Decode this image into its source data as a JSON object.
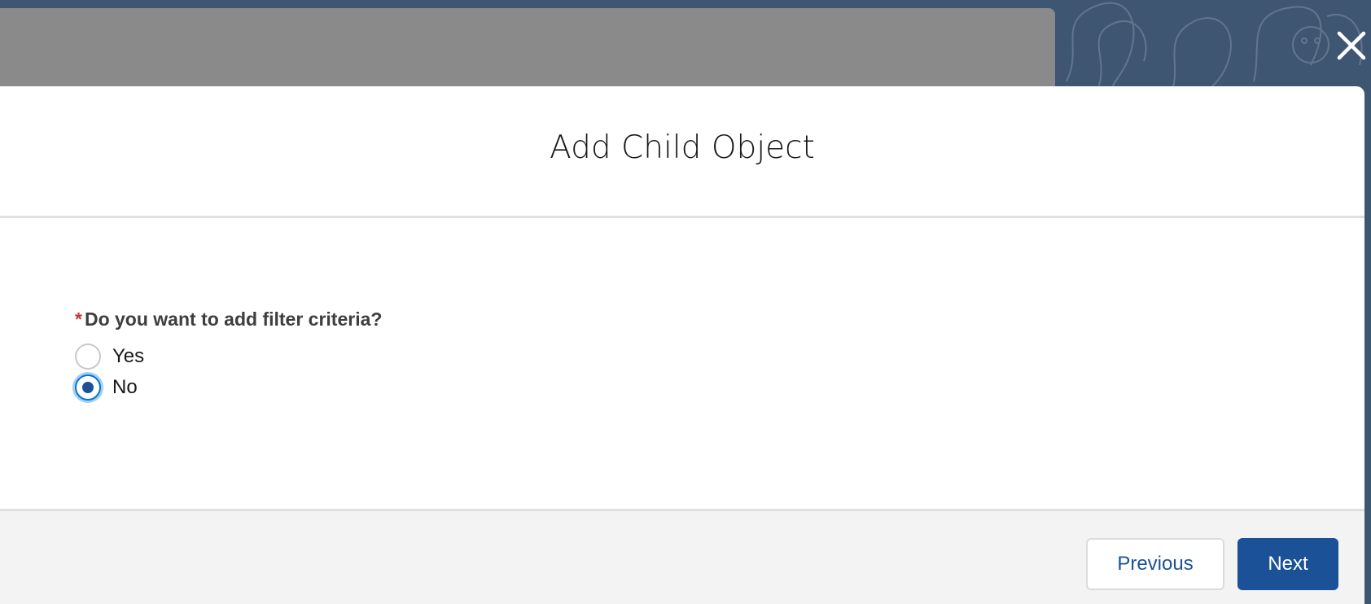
{
  "modal": {
    "title": "Add Child Object"
  },
  "question": {
    "required_marker": "*",
    "label": "Do you want to add filter criteria?",
    "options": [
      {
        "label": "Yes",
        "selected": false
      },
      {
        "label": "No",
        "selected": true
      }
    ]
  },
  "footer": {
    "previous_label": "Previous",
    "next_label": "Next"
  },
  "icons": {
    "close": "close-icon",
    "radio": "radio-icon"
  },
  "colors": {
    "brand_blue": "#1b5297",
    "focus_blue": "#0176d3",
    "required_red": "#c23934",
    "backdrop": "#3f5673",
    "footer_bg": "#f3f3f3"
  }
}
